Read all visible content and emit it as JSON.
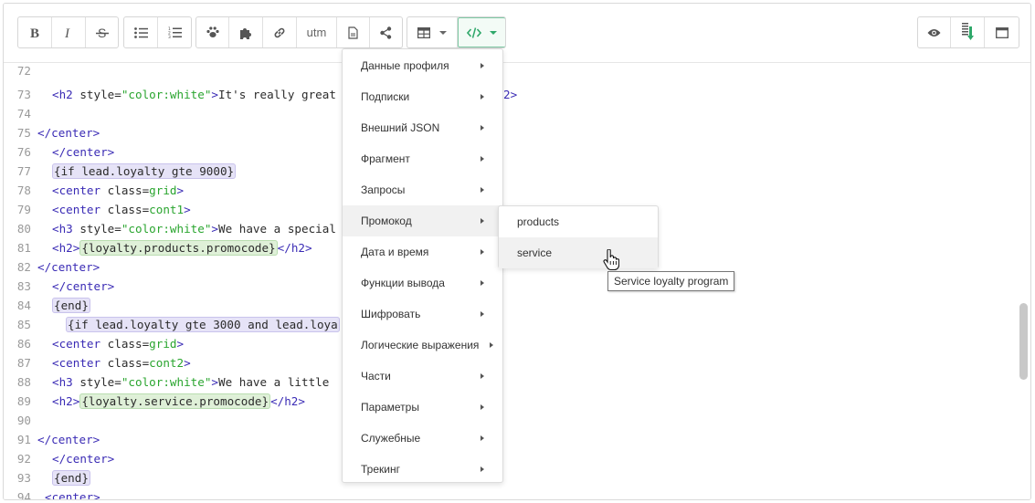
{
  "toolbar": {
    "utm_label": "utm",
    "icons": [
      "bold-icon",
      "italic-icon",
      "strikethrough-icon",
      "bullet-list-icon",
      "numbered-list-icon",
      "paw-icon",
      "puzzle-icon",
      "link-icon",
      "document-icon",
      "share-icon",
      "table-icon",
      "code-icon",
      "eye-icon",
      "download-icon",
      "window-icon"
    ]
  },
  "editor": {
    "lines": [
      {
        "n": "72",
        "text": ""
      },
      {
        "n": "73",
        "text": "It's really great"
      },
      {
        "n": "74",
        "text": ""
      },
      {
        "n": "75",
        "text": "</center>"
      },
      {
        "n": "76",
        "text": "</center>"
      },
      {
        "n": "77",
        "text": "{if lead.loyalty gte 9000}"
      },
      {
        "n": "78",
        "text": "<center class=grid>"
      },
      {
        "n": "79",
        "text": "<center class=cont1>"
      },
      {
        "n": "80",
        "text": "We have a special"
      },
      {
        "n": "81",
        "text": "{loyalty.products.promocode}"
      },
      {
        "n": "82",
        "text": "</center>"
      },
      {
        "n": "83",
        "text": "</center>"
      },
      {
        "n": "84",
        "text": "{end}"
      },
      {
        "n": "85",
        "text": "{if lead.loyalty gte 3000 and lead.loya"
      },
      {
        "n": "86",
        "text": "<center class=grid>"
      },
      {
        "n": "87",
        "text": "<center class=cont2>"
      },
      {
        "n": "88",
        "text": "We have a little"
      },
      {
        "n": "89",
        "text": "{loyalty.service.promocode}"
      },
      {
        "n": "90",
        "text": ""
      },
      {
        "n": "91",
        "text": "</center>"
      },
      {
        "n": "92",
        "text": "</center>"
      },
      {
        "n": "93",
        "text": "{end}"
      },
      {
        "n": "94",
        "text": "<center>"
      }
    ],
    "tokens": {
      "h2_open": "<h2",
      "h3_open": "<h3",
      "style_attr": " style=",
      "color_white": "\"color:white\"",
      "gt": ">",
      "h2_close": "</h2>",
      "h2_close_partial": "2>",
      "h2_tag": "<h2>",
      "center_close": "</center>",
      "center_open": "<center",
      "center_tag": "<center>",
      "class_attr": " class=",
      "grid": "grid",
      "cont1": "cont1",
      "cont2": "cont2"
    }
  },
  "menu": {
    "items": [
      {
        "label": "Данные профиля"
      },
      {
        "label": "Подписки"
      },
      {
        "label": "Внешний JSON"
      },
      {
        "label": "Фрагмент"
      },
      {
        "label": "Запросы"
      },
      {
        "label": "Промокод"
      },
      {
        "label": "Дата и время"
      },
      {
        "label": "Функции вывода"
      },
      {
        "label": "Шифровать"
      },
      {
        "label": "Логические выражения"
      },
      {
        "label": "Части"
      },
      {
        "label": "Параметры"
      },
      {
        "label": "Служебные"
      },
      {
        "label": "Трекинг"
      }
    ],
    "submenu": [
      {
        "label": "products"
      },
      {
        "label": "service"
      }
    ],
    "tooltip": "Service loyalty program"
  },
  "colors": {
    "tag": "#3a2bb5",
    "string": "#2aa52f",
    "template_bg": "#e6e3f7",
    "variable_bg": "#dff0d8",
    "accent": "#2fa86a"
  }
}
